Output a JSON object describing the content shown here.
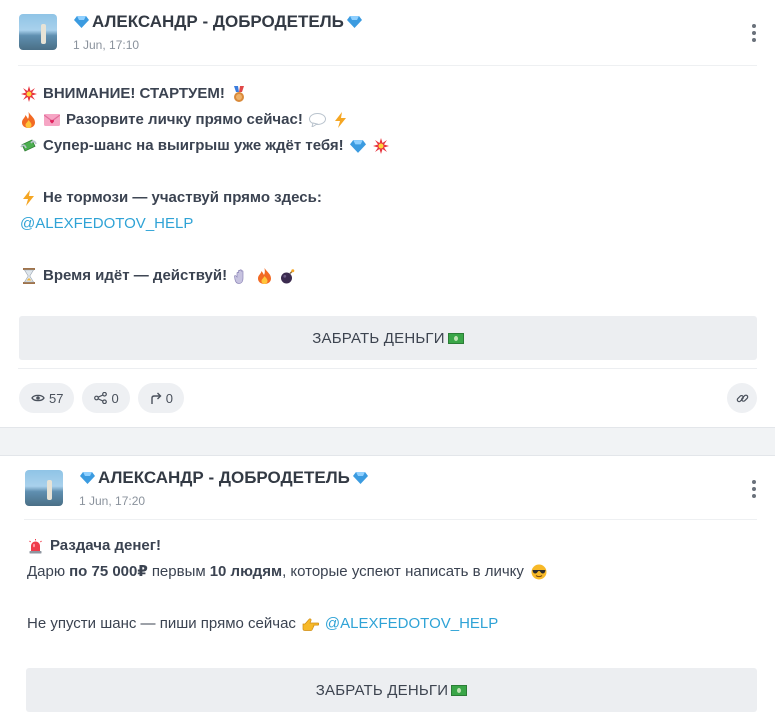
{
  "posts": [
    {
      "author": "АЛЕКСАНДР - ДОБРОДЕТЕЛЬ",
      "time": "1 Jun, 17:10",
      "lines": {
        "l1": "ВНИМАНИЕ! СТАРТУЕМ!",
        "l2": "Разорвите личку прямо сейчас!",
        "l3": "Супер-шанс на выигрыш уже ждёт тебя!",
        "l4": "Не тормози — участвуй прямо здесь:",
        "l5": "@ALEXFEDOTOV_HELP",
        "l6": "Время идёт — действуй!"
      },
      "button_label": "ЗАБРАТЬ ДЕНЬГИ",
      "views": "57",
      "shares": "0",
      "forwards": "0"
    },
    {
      "author": "АЛЕКСАНДР - ДОБРОДЕТЕЛЬ",
      "time": "1 Jun, 17:20",
      "lines": {
        "title": "Раздача денег!",
        "p1_a": "Дарю",
        "p1_b": "по 75 000₽",
        "p1_c": "первым",
        "p1_d": "10 людям",
        "p1_e": ", которые успеют написать в личку",
        "p2_a": "Не упусти шанс — пиши прямо сейчас",
        "p2_link": "@ALEXFEDOTOV_HELP"
      },
      "button_label": "ЗАБРАТЬ ДЕНЬГИ"
    }
  ],
  "icons": {
    "gem": "gem-icon",
    "explosion": "collision-icon",
    "medal": "medal-icon",
    "fire": "fire-icon",
    "letter": "love-letter-icon",
    "bubble": "speech-bubble-icon",
    "lightning": "lightning-icon",
    "money_wings": "money-with-wings-icon",
    "hourglass": "hourglass-icon",
    "hand": "hand-icon",
    "bomb": "bomb-icon",
    "siren": "siren-icon",
    "cool": "sunglasses-face-icon",
    "point": "pointing-hand-icon",
    "cash": "banknote-icon"
  },
  "colors": {
    "link": "#2fa3d6",
    "gem": "#3b9be0",
    "button_bg": "#eceef1",
    "pill_bg": "#eef0f3"
  }
}
